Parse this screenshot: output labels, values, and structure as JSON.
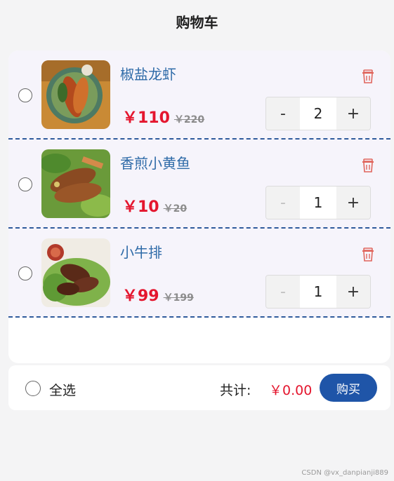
{
  "header": {
    "title": "购物车"
  },
  "items": [
    {
      "name": "椒盐龙虾",
      "price": "￥110",
      "old_price": "￥220",
      "quantity": "2",
      "minus": "-",
      "plus": "+",
      "minus_disabled": false,
      "image_icon": "food-photo-icon"
    },
    {
      "name": "香煎小黄鱼",
      "price": "￥10",
      "old_price": "￥20",
      "quantity": "1",
      "minus": "-",
      "plus": "+",
      "minus_disabled": true,
      "image_icon": "food-photo-icon"
    },
    {
      "name": "小牛排",
      "price": "￥99",
      "old_price": "￥199",
      "quantity": "1",
      "minus": "-",
      "plus": "+",
      "minus_disabled": true,
      "image_icon": "food-photo-icon"
    }
  ],
  "footer": {
    "select_all": "全选",
    "total_label": "共计:",
    "total_value": "￥0.00",
    "buy_label": "购买"
  },
  "watermark": "CSDN @vx_danpianji889",
  "colors": {
    "accent": "#1f55a8",
    "price": "#e4162e",
    "name": "#2f6ba8",
    "trash": "#e0655c",
    "divider": "#2f5b9c"
  }
}
